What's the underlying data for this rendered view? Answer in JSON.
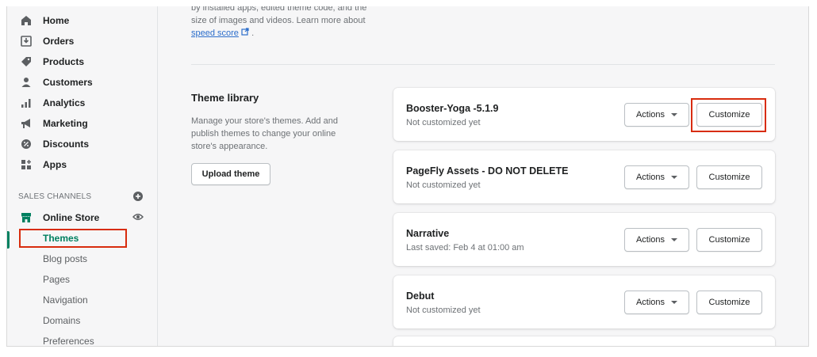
{
  "sidebar": {
    "items": [
      {
        "label": "Home",
        "icon": "home-icon"
      },
      {
        "label": "Orders",
        "icon": "orders-icon"
      },
      {
        "label": "Products",
        "icon": "tag-icon"
      },
      {
        "label": "Customers",
        "icon": "person-icon"
      },
      {
        "label": "Analytics",
        "icon": "bar-chart-icon"
      },
      {
        "label": "Marketing",
        "icon": "megaphone-icon"
      },
      {
        "label": "Discounts",
        "icon": "discount-icon"
      },
      {
        "label": "Apps",
        "icon": "apps-icon"
      }
    ],
    "sales_channels_label": "SALES CHANNELS",
    "online_store_label": "Online Store",
    "subitems": [
      "Themes",
      "Blog posts",
      "Pages",
      "Navigation",
      "Domains",
      "Preferences"
    ],
    "active_subitem": "Themes",
    "accent_color": "#008060"
  },
  "main": {
    "intro_text_1": "by installed apps, edited theme code, and the size of images and videos. Learn more about",
    "speed_score_link": "speed score",
    "intro_text_2": ".",
    "theme_library": {
      "title": "Theme library",
      "description": "Manage your store's themes. Add and publish themes to change your online store's appearance.",
      "upload_button": "Upload theme"
    },
    "themes": [
      {
        "name": "Booster-Yoga -5.1.9",
        "status": "Not customized yet",
        "actions_label": "Actions",
        "customize_label": "Customize"
      },
      {
        "name": "PageFly Assets - DO NOT DELETE",
        "status": "Not customized yet",
        "actions_label": "Actions",
        "customize_label": "Customize"
      },
      {
        "name": "Narrative",
        "status": "Last saved: Feb 4 at 01:00 am",
        "actions_label": "Actions",
        "customize_label": "Customize"
      },
      {
        "name": "Debut",
        "status": "Not customized yet",
        "actions_label": "Actions",
        "customize_label": "Customize"
      }
    ],
    "highlight_color": "#d82c0d"
  }
}
